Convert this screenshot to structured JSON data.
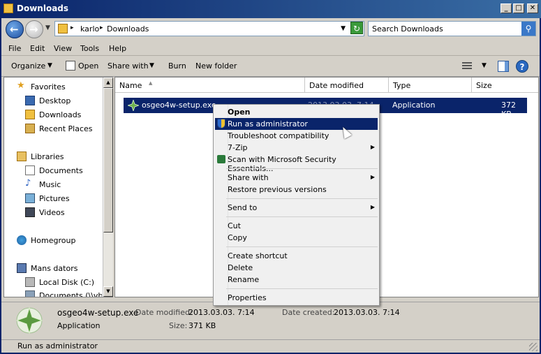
{
  "window": {
    "title": "Downloads",
    "buttons": [
      "_",
      "□",
      "✕"
    ]
  },
  "address": {
    "crumbs": [
      "karlo",
      "Downloads"
    ],
    "separator": "▸"
  },
  "search": {
    "placeholder": "Search Downloads"
  },
  "menubar": [
    "File",
    "Edit",
    "View",
    "Tools",
    "Help"
  ],
  "toolbar": {
    "organize": "Organize",
    "open": "Open",
    "share_with": "Share with",
    "burn": "Burn",
    "new_folder": "New folder"
  },
  "nav": {
    "favorites": "Favorites",
    "desktop": "Desktop",
    "downloads": "Downloads",
    "recent": "Recent Places",
    "libraries": "Libraries",
    "documents": "Documents",
    "music": "Music",
    "pictures": "Pictures",
    "videos": "Videos",
    "homegroup": "Homegroup",
    "computer": "Mans dators",
    "localdisk": "Local Disk (C:)",
    "docs_vbox": "Documents (\\\\vbox"
  },
  "columns": {
    "name": "Name",
    "date": "Date modified",
    "type": "Type",
    "size": "Size"
  },
  "file": {
    "name": "osgeo4w-setup.exe",
    "date": "2013.03.03. 7:14",
    "type": "Application",
    "size": "372 KB"
  },
  "context_menu": {
    "open": "Open",
    "run_admin": "Run as administrator",
    "troubleshoot": "Troubleshoot compatibility",
    "sevenzip": "7-Zip",
    "scan": "Scan with Microsoft Security Essentials...",
    "share_with": "Share with",
    "restore": "Restore previous versions",
    "send_to": "Send to",
    "cut": "Cut",
    "copy": "Copy",
    "create_shortcut": "Create shortcut",
    "delete": "Delete",
    "rename": "Rename",
    "properties": "Properties",
    "submenu_arrow": "▶"
  },
  "details": {
    "filename": "osgeo4w-setup.exe",
    "date_modified_label": "Date modified:",
    "date_modified": "2013.03.03. 7:14",
    "date_created_label": "Date created:",
    "date_created": "2013.03.03. 7:14",
    "type": "Application",
    "size_label": "Size:",
    "size": "371 KB"
  },
  "status": "Run as administrator"
}
